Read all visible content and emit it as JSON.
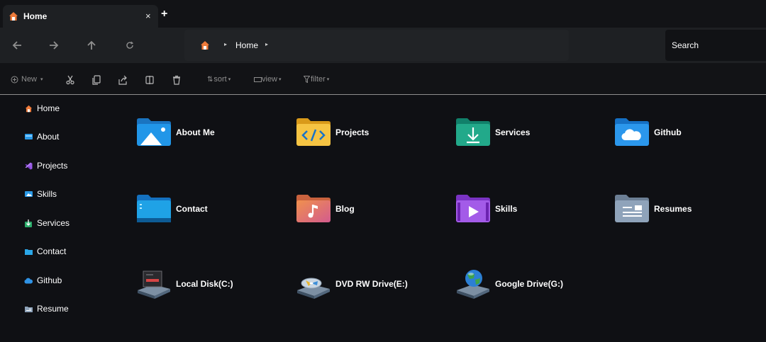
{
  "tab": {
    "title": "Home",
    "close": "×",
    "new_tab": "+"
  },
  "address": {
    "crumb": "Home"
  },
  "search": {
    "placeholder": "Search"
  },
  "toolbar": {
    "new_label": "New",
    "sort_label": "sort",
    "view_label": "view",
    "filter_label": "filter"
  },
  "sidebar": {
    "items": [
      {
        "label": "Home",
        "icon": "home-icon"
      },
      {
        "label": "About",
        "icon": "about-icon"
      },
      {
        "label": "Projects",
        "icon": "vscode-icon"
      },
      {
        "label": "Skills",
        "icon": "skills-icon"
      },
      {
        "label": "Services",
        "icon": "services-icon"
      },
      {
        "label": "Contact",
        "icon": "contact-icon"
      },
      {
        "label": "Github",
        "icon": "cloud-icon"
      },
      {
        "label": "Resume",
        "icon": "resume-icon"
      }
    ]
  },
  "tiles": [
    {
      "label": "About Me",
      "icon": "folder-pictures-icon",
      "color": "#1a8ad8"
    },
    {
      "label": "Projects",
      "icon": "folder-code-icon",
      "color": "#f2b52a"
    },
    {
      "label": "Services",
      "icon": "folder-downloads-icon",
      "color": "#1b9c7c"
    },
    {
      "label": "Github",
      "icon": "folder-cloud-icon",
      "color": "#1f8be0"
    },
    {
      "label": "Contact",
      "icon": "folder-desktop-icon",
      "color": "#1d9be2"
    },
    {
      "label": "Blog",
      "icon": "folder-music-icon",
      "color": "#e07c63"
    },
    {
      "label": "Skills",
      "icon": "folder-videos-icon",
      "color": "#9b4fe0"
    },
    {
      "label": "Resumes",
      "icon": "folder-documents-icon",
      "color": "#7f93ac"
    },
    {
      "label": "Local Disk(C:)",
      "icon": "hard-drive-icon",
      "color": "#5b6e82"
    },
    {
      "label": "DVD RW Drive(E:)",
      "icon": "dvd-drive-icon",
      "color": "#5b6e82"
    },
    {
      "label": "Google Drive(G:)",
      "icon": "globe-drive-icon",
      "color": "#2f8f3f"
    }
  ]
}
